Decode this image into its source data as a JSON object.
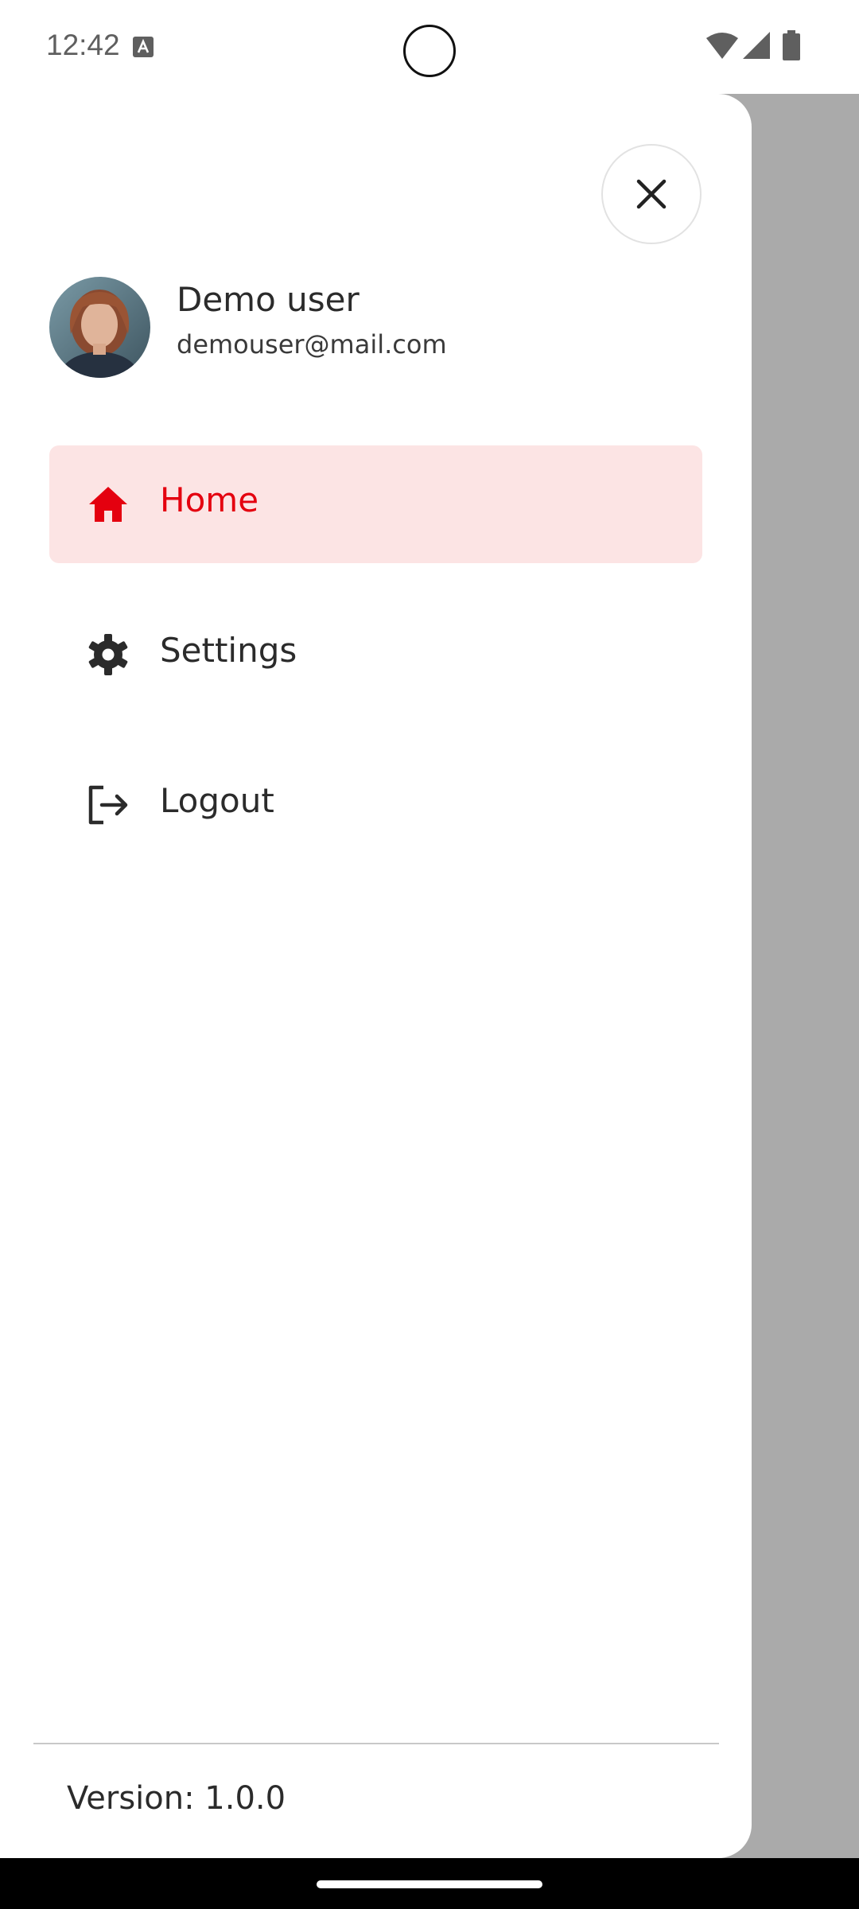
{
  "status_bar": {
    "time": "12:42",
    "icons": [
      "text-a-icon",
      "wifi-icon",
      "signal-icon",
      "battery-icon"
    ]
  },
  "drawer": {
    "close_icon": "close-icon",
    "user": {
      "name": "Demo user",
      "email": "demouser@mail.com"
    },
    "menu": [
      {
        "label": "Home",
        "icon": "home-icon",
        "active": true
      },
      {
        "label": "Settings",
        "icon": "gear-icon",
        "active": false
      },
      {
        "label": "Logout",
        "icon": "logout-icon",
        "active": false
      }
    ],
    "version": "Version: 1.0.0"
  },
  "colors": {
    "accent": "#e4000f",
    "active_bg": "#fce4e4",
    "scrim": "#aaaaaa"
  }
}
